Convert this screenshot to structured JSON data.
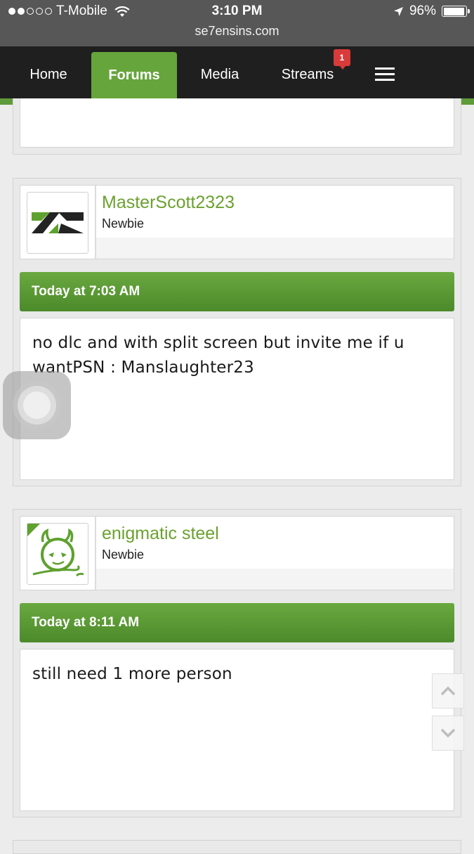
{
  "status_bar": {
    "carrier": "T-Mobile",
    "time": "3:10 PM",
    "battery": "96%",
    "battery_level": 0.96,
    "url": "se7ensins.com"
  },
  "nav": {
    "tabs": [
      {
        "label": "Home"
      },
      {
        "label": "Forums",
        "active": true
      },
      {
        "label": "Media"
      },
      {
        "label": "Streams",
        "badge": "1"
      }
    ],
    "menu_icon": "hamburger-menu-icon"
  },
  "posts": [
    {
      "username": "MasterScott2323",
      "user_title": "Newbie",
      "date": "Today at 7:03 AM",
      "message": "no dlc and with split screen but invite me if u wantPSN : Manslaughter23"
    },
    {
      "username": "enigmatic steel",
      "user_title": "Newbie",
      "date": "Today at 8:11 AM",
      "message": "still need 1 more person"
    }
  ],
  "colors": {
    "accent_green": "#66a53c",
    "username_green": "#6ba12f",
    "nav_bg": "#1f1f1f",
    "badge_red": "#d93a3a"
  }
}
